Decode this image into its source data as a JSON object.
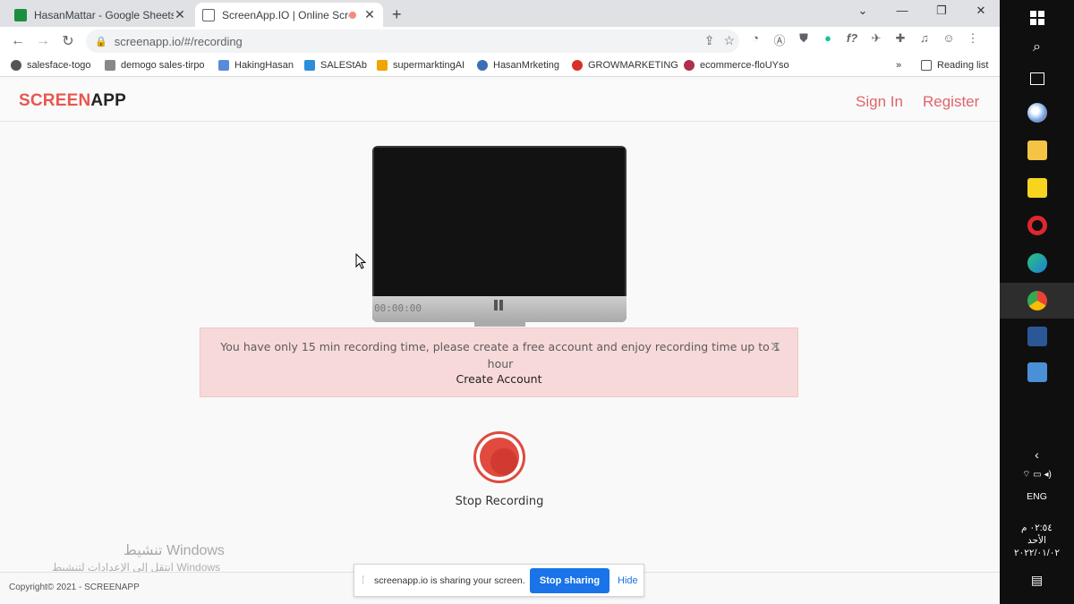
{
  "browser": {
    "tabs": [
      {
        "title": "HasanMattar - Google Sheets",
        "active": false
      },
      {
        "title": "ScreenApp.IO | Online Screen",
        "active": true
      }
    ],
    "url": "screenapp.io/#/recording",
    "bookmarks": [
      {
        "label": "salesface-togo",
        "color": "#555555"
      },
      {
        "label": "demogo sales-tirpo",
        "color": "#888888"
      },
      {
        "label": "HakingHasan",
        "color": "#5b8bd8"
      },
      {
        "label": "SALEStAb",
        "color": "#2a8fd8"
      },
      {
        "label": "supermarktingAI",
        "color": "#f0a500"
      },
      {
        "label": "HasanMrketing",
        "color": "#3b6fb5"
      },
      {
        "label": "GROWMARKETING",
        "color": "#d93025"
      },
      {
        "label": "ecommerce-floUYso",
        "color": "#b0304a"
      }
    ],
    "reading_list": "Reading list"
  },
  "site": {
    "logo_part1": "SCREEN",
    "logo_part2": "APP",
    "sign_in": "Sign In",
    "register": "Register",
    "timer": "00:00:00",
    "alert_message": "You have only 15 min recording time, please create a free account and enjoy recording time up to 1 hour",
    "alert_link": "Create Account",
    "alert_close": "×",
    "record_label": "Stop Recording",
    "copyright": "Copyright©   2021 - SCREENAPP"
  },
  "watermark": {
    "line1": "تنشيط Windows",
    "line2": "انتقل إلى الإعدادات لتنشيط Windows"
  },
  "share_bar": {
    "message": "screenapp.io is sharing your screen.",
    "stop": "Stop sharing",
    "hide": "Hide"
  },
  "taskbar": {
    "language": "ENG",
    "time": "٠٢:٥٤ م",
    "day": "الأحد",
    "date": "٢٠٢٢/٠١/٠٢"
  },
  "colors": {
    "brand": "#e8574f",
    "alert_bg": "#f8d9d9",
    "record": "#e04a3f",
    "share_blue": "#1a73e8"
  }
}
